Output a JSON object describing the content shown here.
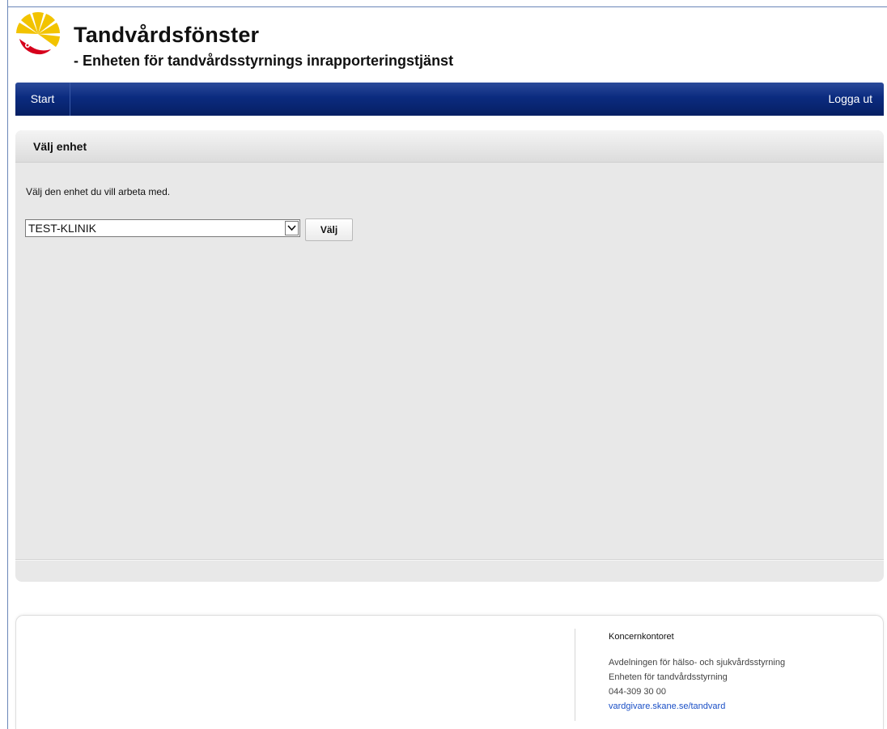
{
  "header": {
    "title": "Tandvårdsfönster",
    "subtitle": "- Enheten för tandvårdsstyrnings inrapporteringstjänst",
    "logo_icon": "region-skane-griffin-logo",
    "logo_color": "#f2c300",
    "logo_accent_color": "#d6001c"
  },
  "navbar": {
    "start_label": "Start",
    "logout_label": "Logga ut",
    "color": "#0b2b7f"
  },
  "panel": {
    "title": "Välj enhet",
    "instruction": "Välj den enhet du vill arbeta med.",
    "unit_select": {
      "selected": "TEST-KLINIK"
    },
    "choose_button_label": "Välj"
  },
  "footer": {
    "organization": "Koncernkontoret",
    "lines": [
      "Avdelningen för hälso- och sjukvårdsstyrning",
      "Enheten för tandvårdsstyrning",
      "044-309 30 00"
    ],
    "link": "vardgivare.skane.se/tandvard"
  }
}
